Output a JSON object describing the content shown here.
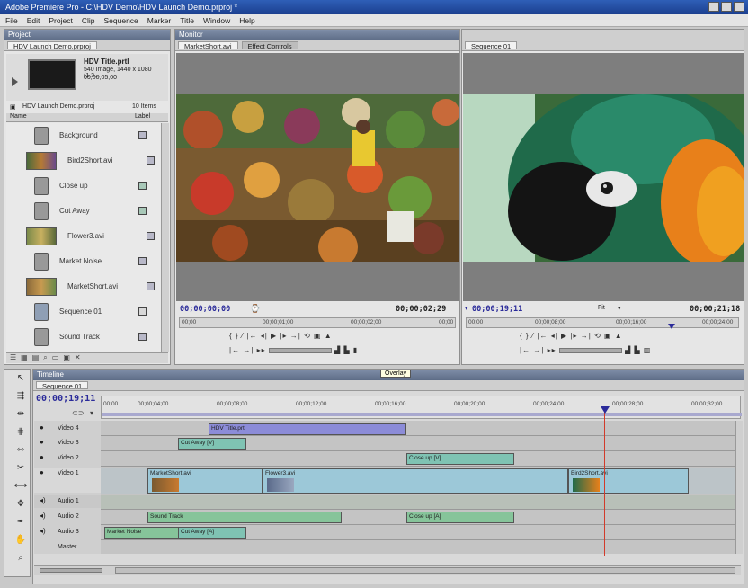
{
  "window": {
    "title": "Adobe Premiere Pro - C:\\HDV Demo\\HDV Launch Demo.prproj *"
  },
  "menu": [
    "File",
    "Edit",
    "Project",
    "Clip",
    "Sequence",
    "Marker",
    "Title",
    "Window",
    "Help"
  ],
  "project_panel": {
    "title": "Project",
    "tab_label": "HDV Launch Demo.prproj",
    "preview": {
      "name": "HDV Title.prtl",
      "info_line1": "540 Image, 1440 x 1080 (1.3...",
      "info_line2": "00;00;05;00"
    },
    "project_file": "HDV Launch Demo.prproj",
    "item_count": "10 Items",
    "col_name": "Name",
    "col_label": "Label",
    "items": [
      {
        "name": "Background",
        "type": "clip",
        "label_color": "#b8b8c8"
      },
      {
        "name": "Bird2Short.avi",
        "type": "film",
        "label_color": "#b8b8c8"
      },
      {
        "name": "Close up",
        "type": "clip",
        "label_color": "#a8c8b8"
      },
      {
        "name": "Cut Away",
        "type": "clip",
        "label_color": "#a8c8b8"
      },
      {
        "name": "Flower3.avi",
        "type": "film",
        "label_color": "#b8b8c8"
      },
      {
        "name": "Market Noise",
        "type": "clip",
        "label_color": "#b8b8c8"
      },
      {
        "name": "MarketShort.avi",
        "type": "film",
        "label_color": "#b8b8c8"
      },
      {
        "name": "Sequence 01",
        "type": "seq",
        "label_color": "#d8d8d8"
      },
      {
        "name": "Sound Track",
        "type": "clip",
        "label_color": "#b8b8c8"
      }
    ]
  },
  "source_monitor": {
    "panel_title": "Monitor",
    "tab1": "MarketShort.avi",
    "tab2": "Effect Controls",
    "timecode_left": "00;00;00;00",
    "timecode_right": "00;00;02;29",
    "ruler_start": "00;00",
    "ruler_mid1": "00;00;01;00",
    "ruler_mid2": "00;00;02;00",
    "ruler_end": "00;00"
  },
  "program_monitor": {
    "tab": "Sequence 01",
    "timecode_left": "00;00;19;11",
    "fit_label": "Fit",
    "timecode_right": "00;00;21;18",
    "ruler_start": "00;00",
    "ruler_mid1": "00;00;08;00",
    "ruler_mid2": "00;00;16;00",
    "ruler_end": "00;00;24;00"
  },
  "timeline": {
    "title": "Timeline",
    "tab": "Sequence 01",
    "overlay_tooltip": "Overlay",
    "timecode": "00;00;19;11",
    "ruler": [
      "00;00",
      "00;00;04;00",
      "00;00;08;00",
      "00;00;12;00",
      "00;00;16;00",
      "00;00;20;00",
      "00;00;24;00",
      "00;00;28;00",
      "00;00;32;00"
    ],
    "tracks": [
      {
        "name": "Video 4",
        "kind": "video"
      },
      {
        "name": "Video 3",
        "kind": "video"
      },
      {
        "name": "Video 2",
        "kind": "video"
      },
      {
        "name": "Video 1",
        "kind": "video"
      },
      {
        "name": "Audio 1",
        "kind": "audio"
      },
      {
        "name": "Audio 2",
        "kind": "audio"
      },
      {
        "name": "Audio 3",
        "kind": "audio"
      },
      {
        "name": "Master",
        "kind": "master"
      }
    ],
    "clips": {
      "v4": "HDV Title.prtl",
      "v3": "Cut Away [V]",
      "v2": "Close up [V]",
      "v1a": "MarketShort.avi",
      "v1b": "Flower3.avi",
      "v1c": "Bird2Short.avi",
      "a2a": "Sound Track",
      "a2b": "Close up [A]",
      "a3a": "Market Noise",
      "a3b": "Cut Away [A]"
    }
  },
  "colors": {
    "title_blue": "#2f5fb7",
    "clip_title": "#8c8cd8",
    "clip_video": "#7fc3b3",
    "clip_audio": "#86c49a",
    "playhead": "#d23a2a"
  }
}
